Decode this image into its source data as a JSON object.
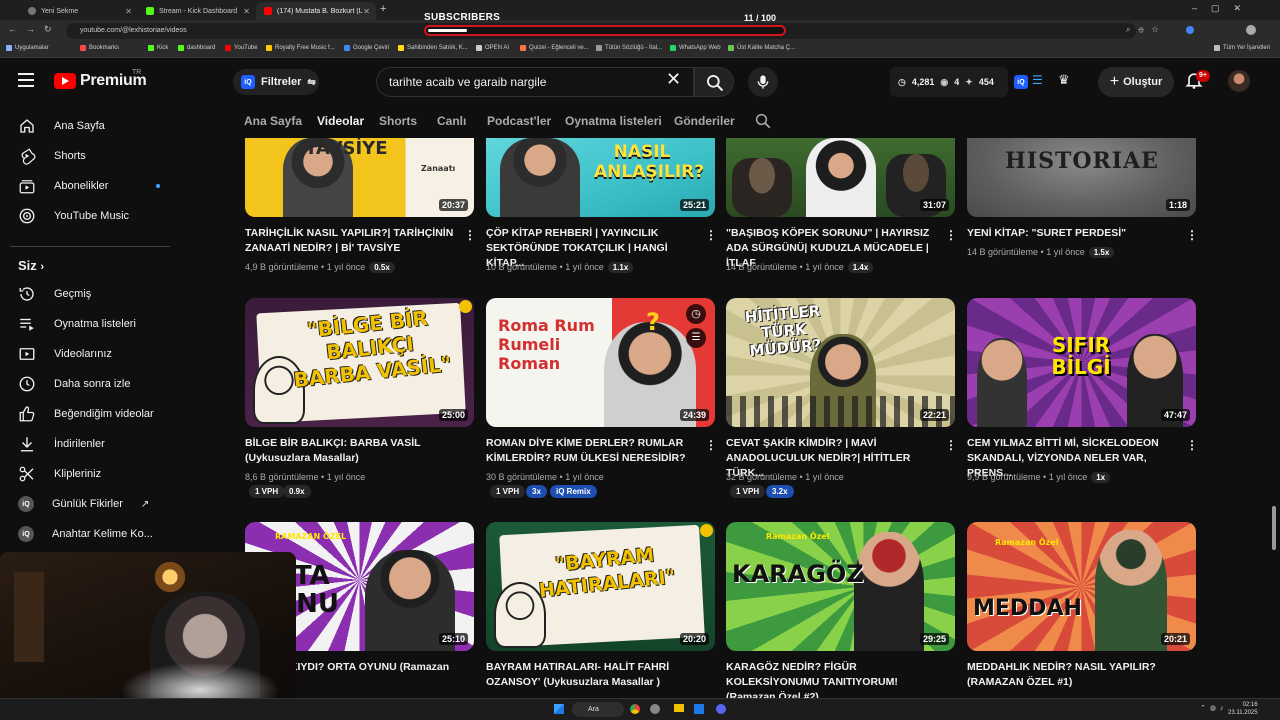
{
  "browser": {
    "tabs": [
      {
        "label": "Yeni Sekme"
      },
      {
        "label": "Stream - Kick Dashboard"
      },
      {
        "label": "(174) Mustafa B. Bozkurt (Lex H..."
      }
    ],
    "url": "youtube.com/@lexhistoriae/videos",
    "bookmarks": [
      "Uygulamalar",
      "Bookmarks",
      "Kick",
      "dashboard",
      "YouTube",
      "Royalty Free Music f...",
      "Google Çeviri",
      "Sahibinden Satılık, K...",
      "OPEN AI",
      "Quizei - Eğlenceli ve...",
      "Tütün Sözlüğü - İtal...",
      "WhatsApp Web",
      "Üst Kalite Matcha Ç...",
      "Tüm Yer İşaretleri"
    ]
  },
  "overlay": {
    "label": "SUBSCRIBERS",
    "current": "11",
    "goal": "/ 100",
    "progress": 0.11
  },
  "header": {
    "logo_text": "Premium",
    "logo_region": "TR",
    "filters_label": "Filtreler",
    "search_value": "tarihte acaib ve garaib nargile",
    "stats": {
      "views": "4,281",
      "watching": "4",
      "other": "454"
    },
    "create_label": "Oluştur",
    "notif_badge": "9+"
  },
  "sidebar": {
    "items": [
      {
        "label": "Ana Sayfa",
        "icon": "home-icon"
      },
      {
        "label": "Shorts",
        "icon": "shorts-icon"
      },
      {
        "label": "Abonelikler",
        "icon": "subscriptions-icon"
      },
      {
        "label": "YouTube Music",
        "icon": "music-icon"
      }
    ],
    "section_title": "Siz",
    "you_items": [
      {
        "label": "Geçmiş"
      },
      {
        "label": "Oynatma listeleri"
      },
      {
        "label": "Videolarınız"
      },
      {
        "label": "Daha sonra izle"
      },
      {
        "label": "Beğendiğim videolar"
      },
      {
        "label": "İndirilenler"
      },
      {
        "label": "Klipleriniz"
      },
      {
        "label": "Günlük Fikirler"
      },
      {
        "label": "Anahtar Kelime Ko..."
      }
    ]
  },
  "channel_tabs": [
    "Ana Sayfa",
    "Videolar",
    "Shorts",
    "Canlı",
    "Podcast'ler",
    "Oynatma listeleri",
    "Gönderiler"
  ],
  "active_tab": "Videolar",
  "videos": [
    {
      "title": "TARİHÇİLİK NASIL YAPILIR?| TARİHÇİNİN ZANAATİ NEDİR? | Bİ' TAVSİYE",
      "views": "4,9 B görüntüleme",
      "age": "1 yıl önce",
      "mult": "0.5x",
      "duration": "20:37",
      "thumb_text": "TAVSİYE",
      "thumb_sub": "Zanaatı"
    },
    {
      "title": "ÇÖP KİTAP REHBERİ | YAYINCILIK SEKTÖRÜNDE TOKATÇILIK | HANGİ KİTAP...",
      "views": "10 B görüntüleme",
      "age": "1 yıl önce",
      "mult": "1.1x",
      "duration": "25:21",
      "thumb_text": "NASIL ANLAŞILIR?"
    },
    {
      "title": "\"BAŞIBOŞ KÖPEK SORUNU\" | HAYIRSIZ ADA SÜRGÜNÜ| KUDUZLA MÜCADELE | İTLAF",
      "views": "14 B görüntüleme",
      "age": "1 yıl önce",
      "mult": "1.4x",
      "duration": "31:07"
    },
    {
      "title": "YENİ KİTAP: \"SURET PERDESİ\"",
      "views": "14 B görüntüleme",
      "age": "1 yıl önce",
      "mult": "1.5x",
      "duration": "1:18",
      "thumb_text": "HISTORIAE"
    },
    {
      "title": "BİLGE BİR BALIKÇI: BARBA VASİL (Uykusuzlara Masallar)",
      "views": "8,6 B görüntüleme",
      "age": "1 yıl önce",
      "vph": "1 VPH",
      "mult": "0.9x",
      "duration": "25:00",
      "thumb_text": "\"BİLGE BİR BALIKÇI BARBA VASİL\""
    },
    {
      "title": "ROMAN DİYE KİME DERLER? RUMLAR KİMLERDİR? RUM ÜLKESİ NERESİDİR?",
      "views": "30 B görüntüleme",
      "age": "1 yıl önce",
      "vph": "1 VPH",
      "mult": "3x",
      "remix": "Remix",
      "duration": "24:39",
      "thumb_text": "Roma Rum Rumeli Roman"
    },
    {
      "title": "CEVAT ŞAKİR KİMDİR? | MAVİ ANADOLUCULUK NEDİR?| HİTİTLER TÜRK...",
      "views": "32 B görüntüleme",
      "age": "1 yıl önce",
      "vph": "1 VPH",
      "mult": "3.2x",
      "duration": "22:21",
      "thumb_text": "HİTİTLER TÜRK MÜDÜR?"
    },
    {
      "title": "CEM YILMAZ BİTTİ Mİ, SİCKELODEON SKANDALI, VİZYONDA NELER VAR, PRENS...",
      "views": "9,9 B görüntüleme",
      "age": "1 yıl önce",
      "mult": "1x",
      "duration": "47:47",
      "thumb_text": "SIFIR BİLGİ"
    },
    {
      "title": "MİN HAKKIYDI? ORTA OYUNU (Ramazan Özel #3)",
      "duration": "25:10",
      "thumb_text": "RTA UNU",
      "thumb_sub": "RAMAZAN ÖZEL"
    },
    {
      "title": "BAYRAM HATIRALARI- HALİT FAHRİ OZANSOY' (Uykusuzlara Masallar )",
      "duration": "20:20",
      "thumb_text": "\"BAYRAM HATIRALARI\""
    },
    {
      "title": "KARAGÖZ NEDİR? FİGÜR KOLEKSİYONUMU TANITIYORUM! (Ramazan Özel #2)",
      "duration": "29:25",
      "thumb_text": "KARAGÖZ",
      "thumb_sub": "Ramazan Özel"
    },
    {
      "title": "MEDDAHLIK NEDİR? NASIL YAPILIR? (RAMAZAN ÖZEL #1)",
      "duration": "20:21",
      "thumb_text": "MEDDAH",
      "thumb_sub": "Ramazan Özel"
    }
  ],
  "taskbar": {
    "search_label": "Ara",
    "time": "02:16",
    "date": "23.11.2025"
  },
  "colors": {
    "accent_red": "#ff0000",
    "badge_blue": "#1d4fb3",
    "overlay_border": "#d4141a"
  }
}
